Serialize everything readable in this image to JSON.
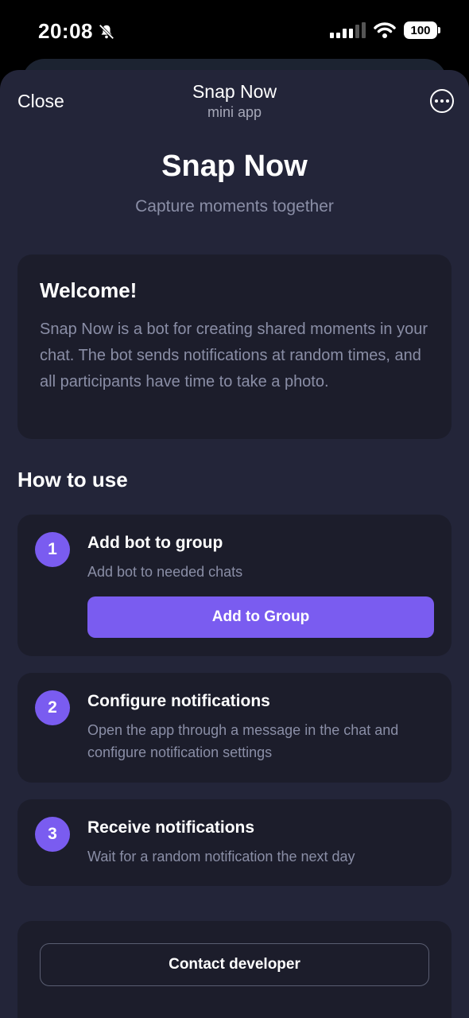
{
  "status_bar": {
    "time": "20:08",
    "battery": "100",
    "icons": [
      "bell-slash-icon",
      "cellular-signal-icon",
      "wifi-icon",
      "battery-icon"
    ]
  },
  "header": {
    "close_label": "Close",
    "title": "Snap Now",
    "subtitle": "mini app",
    "more_icon": "more-options-icon"
  },
  "app": {
    "title": "Snap Now",
    "tagline": "Capture moments together"
  },
  "welcome": {
    "title": "Welcome!",
    "body": "Snap Now is a bot for creating shared moments in your chat. The bot sends notifications at random times, and all participants have time to take a photo."
  },
  "how_to_use": {
    "title": "How to use",
    "steps": [
      {
        "number": "1",
        "title": "Add bot to group",
        "description": "Add bot to needed chats",
        "button_label": "Add to Group"
      },
      {
        "number": "2",
        "title": "Configure notifications",
        "description": "Open the app through a message in the chat and configure notification settings"
      },
      {
        "number": "3",
        "title": "Receive notifications",
        "description": "Wait for a random notification the next day"
      }
    ]
  },
  "footer": {
    "contact_label": "Contact developer"
  },
  "colors": {
    "accent": "#7a5cf0",
    "sheet_background": "#232539",
    "card_background": "#1c1d2b",
    "muted_text": "#8a8ea6"
  }
}
